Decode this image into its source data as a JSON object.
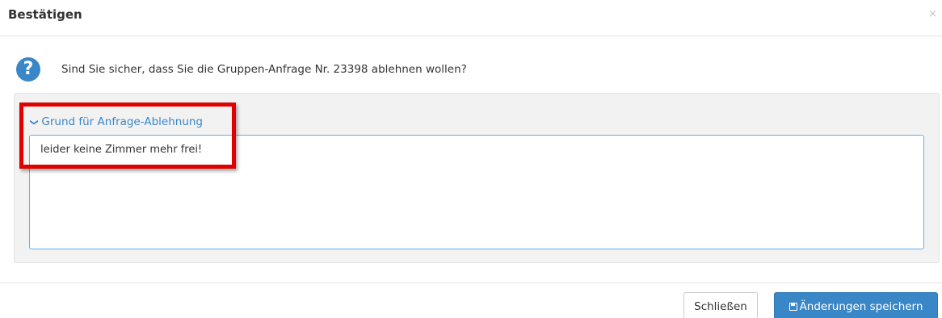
{
  "dialog": {
    "title": "Bestätigen",
    "close_glyph": "×"
  },
  "question": {
    "icon": "question-circle-icon",
    "icon_glyph": "?",
    "text": "Sind Sie sicher, dass Sie die Gruppen-Anfrage Nr. 23398 ablehnen wollen?"
  },
  "reason": {
    "header_label": "Grund für Anfrage-Ablehnung",
    "chevron_glyph": "❯",
    "value": "leider keine Zimmer mehr frei!"
  },
  "footer": {
    "close_label": "Schließen",
    "save_label": "Änderungen speichern"
  },
  "colors": {
    "accent": "#3a87c8",
    "highlight": "#e00000",
    "panel_bg": "#f2f2f2"
  }
}
